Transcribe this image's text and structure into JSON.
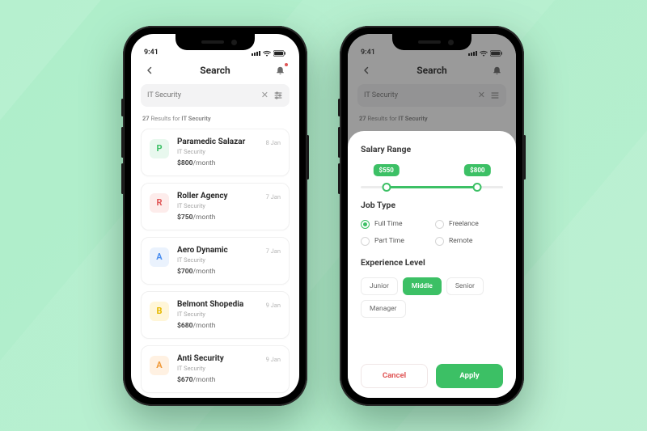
{
  "status": {
    "time": "9:41"
  },
  "header": {
    "title": "Search"
  },
  "search": {
    "value": "IT Security"
  },
  "results": {
    "count": "27",
    "prefix": "Results for",
    "query": "IT Security"
  },
  "jobs": [
    {
      "letter": "P",
      "bg": "#e8f8ee",
      "fg": "#3cc065",
      "title": "Paramedic Salazar",
      "sub": "IT Security",
      "price": "$800",
      "per": "/month",
      "date": "8 Jan"
    },
    {
      "letter": "R",
      "bg": "#fdeceb",
      "fg": "#e05757",
      "title": "Roller Agency",
      "sub": "IT Security",
      "price": "$750",
      "per": "/month",
      "date": "7 Jan"
    },
    {
      "letter": "A",
      "bg": "#eaf2fd",
      "fg": "#4a8ef0",
      "title": "Aero Dynamic",
      "sub": "IT Security",
      "price": "$700",
      "per": "/month",
      "date": "7 Jan"
    },
    {
      "letter": "B",
      "bg": "#fff6d8",
      "fg": "#e6b900",
      "title": "Belmont Shopedia",
      "sub": "IT Security",
      "price": "$680",
      "per": "/month",
      "date": "9 Jan"
    },
    {
      "letter": "A",
      "bg": "#fff1e2",
      "fg": "#f09a3a",
      "title": "Anti Security",
      "sub": "IT Security",
      "price": "$670",
      "per": "/month",
      "date": "9 Jan"
    }
  ],
  "filter": {
    "salary_title": "Salary Range",
    "salary_min": "$550",
    "salary_max": "$800",
    "jobtype_title": "Job Type",
    "jobtypes": [
      {
        "label": "Full Time",
        "selected": true
      },
      {
        "label": "Freelance",
        "selected": false
      },
      {
        "label": "Part Time",
        "selected": false
      },
      {
        "label": "Remote",
        "selected": false
      }
    ],
    "exp_title": "Experience Level",
    "levels": [
      {
        "label": "Junior",
        "selected": false
      },
      {
        "label": "Middle",
        "selected": true
      },
      {
        "label": "Senior",
        "selected": false
      },
      {
        "label": "Manager",
        "selected": false
      }
    ],
    "cancel": "Cancel",
    "apply": "Apply"
  }
}
